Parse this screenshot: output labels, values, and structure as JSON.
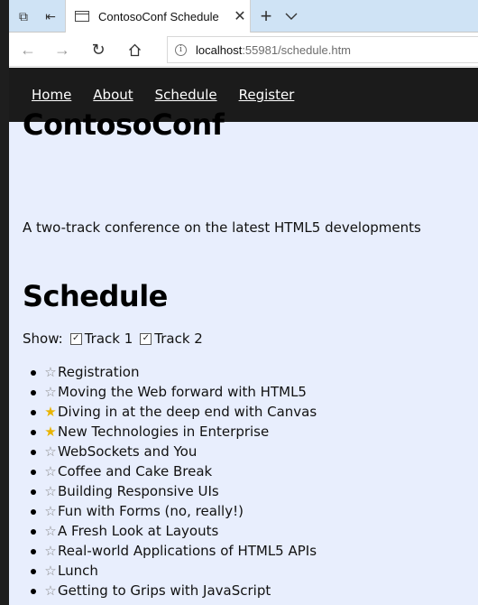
{
  "browser": {
    "tab_title": "ContosoConf Schedule",
    "url_host": "localhost",
    "url_rest": ":55981/schedule.htm"
  },
  "site": {
    "nav": [
      "Home",
      "About",
      "Schedule",
      "Register"
    ],
    "title": "ContosoConf",
    "tagline": "A two-track conference on the latest HTML5 developments",
    "schedule_heading": "Schedule",
    "show_label": "Show:",
    "tracks": [
      {
        "label": "Track 1",
        "checked": true
      },
      {
        "label": "Track 2",
        "checked": true
      }
    ],
    "sessions": [
      {
        "title": "Registration",
        "starred": false
      },
      {
        "title": "Moving the Web forward with HTML5",
        "starred": false
      },
      {
        "title": "Diving in at the deep end with Canvas",
        "starred": true
      },
      {
        "title": "New Technologies in Enterprise",
        "starred": true
      },
      {
        "title": "WebSockets and You",
        "starred": false
      },
      {
        "title": "Coffee and Cake Break",
        "starred": false
      },
      {
        "title": "Building Responsive UIs",
        "starred": false
      },
      {
        "title": "Fun with Forms (no, really!)",
        "starred": false
      },
      {
        "title": "A Fresh Look at Layouts",
        "starred": false
      },
      {
        "title": "Real-world Applications of HTML5 APIs",
        "starred": false
      },
      {
        "title": "Lunch",
        "starred": false
      },
      {
        "title": "Getting to Grips with JavaScript",
        "starred": false
      }
    ]
  },
  "colors": {
    "page_bg": "#e8eefd",
    "nav_bg": "#1b1b1b",
    "star_fav": "#e8b400",
    "star_off": "#8a8a8a"
  }
}
